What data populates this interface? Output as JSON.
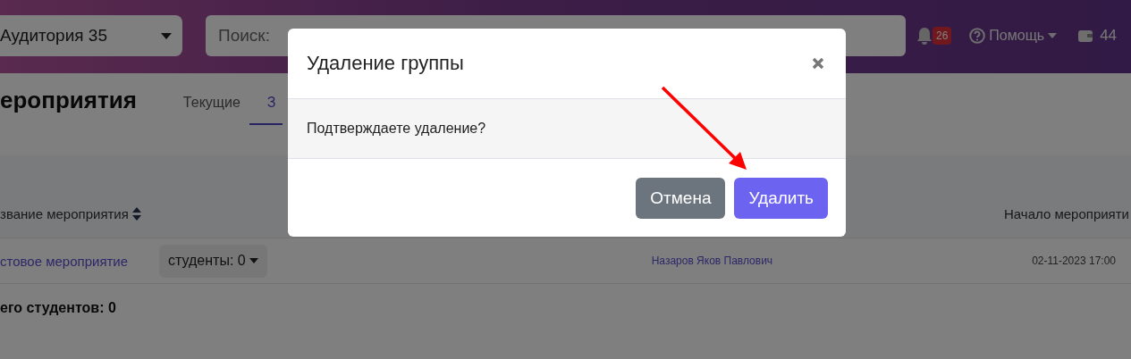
{
  "navbar": {
    "room_select": {
      "value": "Аудитория 35"
    },
    "search": {
      "placeholder": "Поиск:"
    },
    "notifications": {
      "count": "26"
    },
    "help_menu": {
      "label": "Помощь"
    },
    "wallet": {
      "amount": "44"
    }
  },
  "page": {
    "title": "ероприятия",
    "tabs": [
      {
        "label": "Текущие",
        "selected": false
      },
      {
        "label": "З",
        "selected": true
      }
    ]
  },
  "table": {
    "columns": [
      {
        "label": "звание мероприятия",
        "sortable": true
      },
      {
        "label": "Начало мероприяти",
        "sortable": false
      }
    ],
    "rows": [
      {
        "name": "стовое мероприятие",
        "students": "студенты: 0",
        "organizer": "Назаров Яков Павлович",
        "start": "02-11-2023 17:00"
      }
    ],
    "total": "его студентов: 0"
  },
  "dialog": {
    "title": "Удаление группы",
    "message": "Подтверждаете удаление?",
    "buttons": [
      {
        "label": "Отмена",
        "kind": "secondary"
      },
      {
        "label": "Удалить",
        "kind": "primary"
      }
    ]
  }
}
